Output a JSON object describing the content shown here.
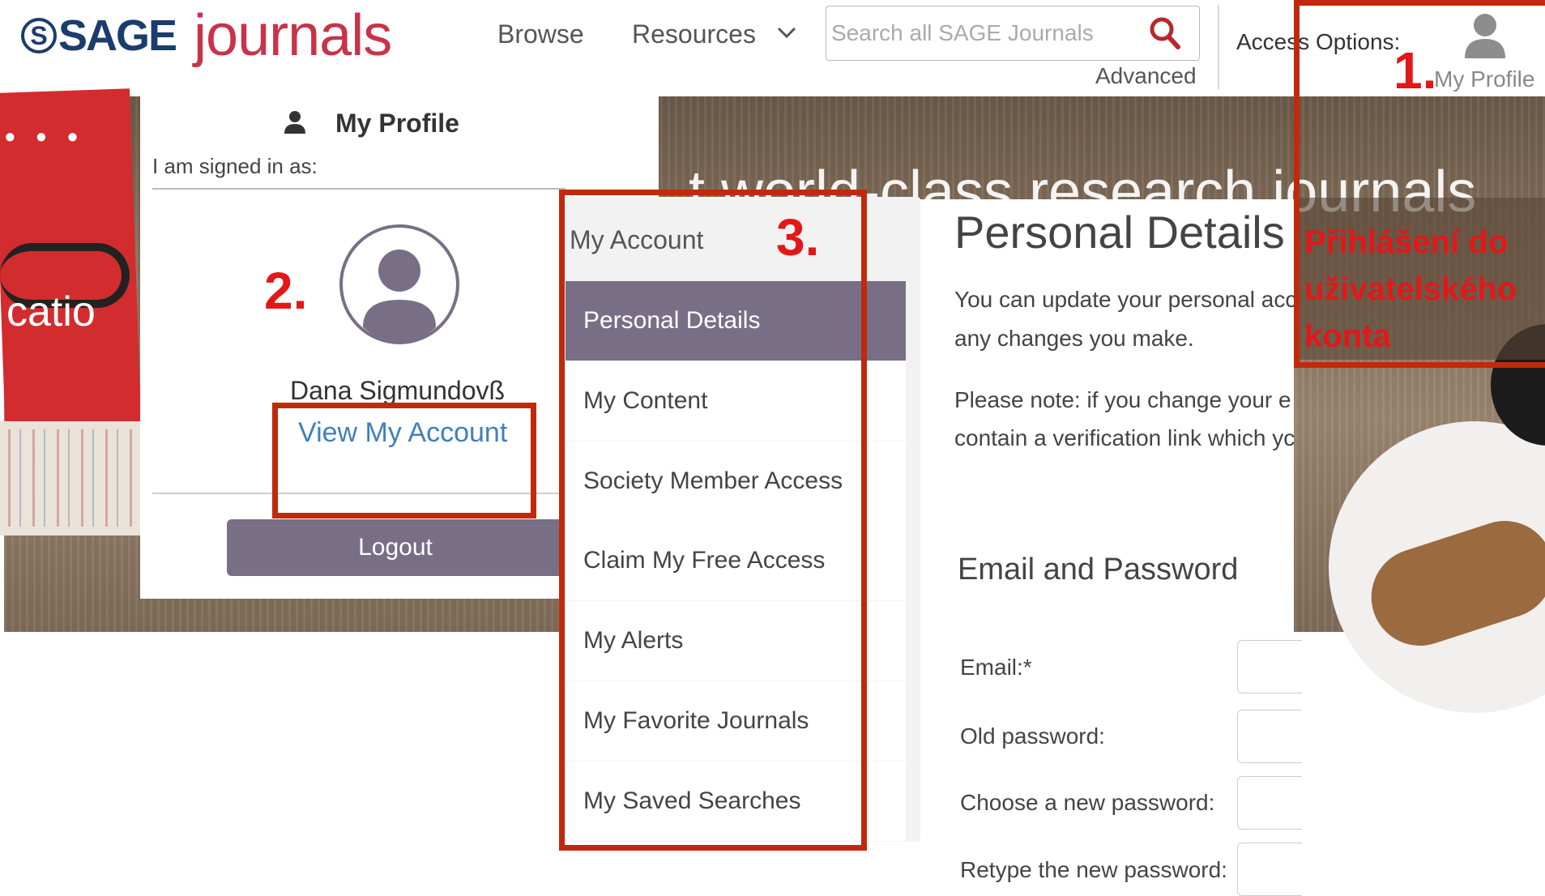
{
  "header": {
    "logo_brand": "SAGE",
    "logo_product": "journals",
    "nav": {
      "browse": "Browse",
      "resources": "Resources"
    },
    "search": {
      "placeholder": "Search all SAGE Journals",
      "advanced_label": "Advanced"
    },
    "access_options_label": "Access Options:",
    "my_profile_label": "My Profile"
  },
  "hero": {
    "banner_text": "t    world-class research journals",
    "book_text": "catio"
  },
  "profile_dropdown": {
    "title": "My Profile",
    "signed_in_label": "I am signed in as:",
    "user_name": "Dana Sigmundovß",
    "view_account_label": "View My Account",
    "logout_label": "Logout"
  },
  "account_sidebar": {
    "header": "My Account",
    "items": [
      {
        "label": "Personal Details",
        "active": true
      },
      {
        "label": "My Content",
        "active": false
      },
      {
        "label": "Society Member Access",
        "active": false
      },
      {
        "label": "Claim My Free Access",
        "active": false
      },
      {
        "label": "My Alerts",
        "active": false
      },
      {
        "label": "My Favorite Journals",
        "active": false
      },
      {
        "label": "My Saved Searches",
        "active": false
      }
    ]
  },
  "content": {
    "title": "Personal Details",
    "para1_line1": "You can update your personal acc",
    "para1_line2": "any changes you make.",
    "para2_line1": "Please note: if you change your e",
    "para2_line2": "contain a verification link which yc",
    "section_heading": "Email and Password",
    "form_labels": [
      "Email:*",
      "Old password:",
      "Choose a new password:",
      "Retype the new password:"
    ]
  },
  "annotations": {
    "step1": "1.",
    "step2": "2.",
    "step3": "3.",
    "caption": "Přihlášení do\nuživatelského\nkonta"
  },
  "colors": {
    "brand_navy": "#1b3d6d",
    "brand_red": "#c8334a",
    "active_purple": "#786f86",
    "link_blue": "#3f7fbf",
    "annotation_red": "#e21818"
  },
  "icons": [
    "search-icon",
    "chevron-down-icon",
    "user-icon",
    "avatar-icon"
  ]
}
